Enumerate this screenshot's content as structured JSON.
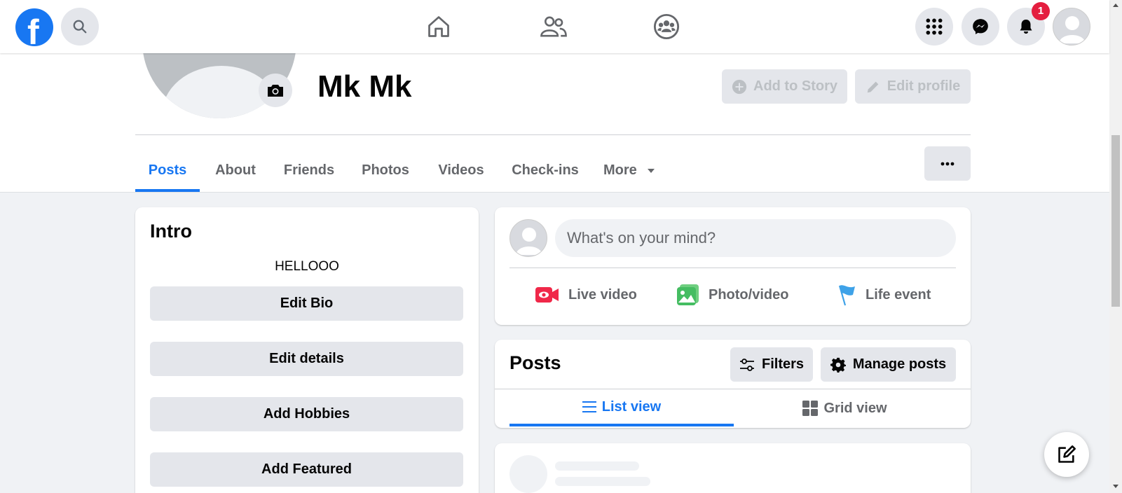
{
  "topbar": {
    "logo_letter": "f",
    "notification_count": "1"
  },
  "profile": {
    "name": "Mk Mk",
    "add_story_label": "Add to Story",
    "edit_profile_label": "Edit profile"
  },
  "tabs": [
    {
      "label": "Posts",
      "active": true
    },
    {
      "label": "About"
    },
    {
      "label": "Friends"
    },
    {
      "label": "Photos"
    },
    {
      "label": "Videos"
    },
    {
      "label": "Check-ins"
    },
    {
      "label": "More"
    }
  ],
  "intro": {
    "title": "Intro",
    "bio": "HELLOOO",
    "buttons": [
      "Edit Bio",
      "Edit details",
      "Add Hobbies",
      "Add Featured"
    ]
  },
  "composer": {
    "placeholder": "What's on your mind?",
    "actions": [
      "Live video",
      "Photo/video",
      "Life event"
    ]
  },
  "posts": {
    "title": "Posts",
    "filters_label": "Filters",
    "manage_label": "Manage posts",
    "list_view_label": "List view",
    "grid_view_label": "Grid view"
  },
  "colors": {
    "brand": "#1877f2",
    "badge": "#e41e3f",
    "live_video": "#f02849",
    "photo_video": "#45bd62",
    "life_event": "#3ea2e8"
  }
}
